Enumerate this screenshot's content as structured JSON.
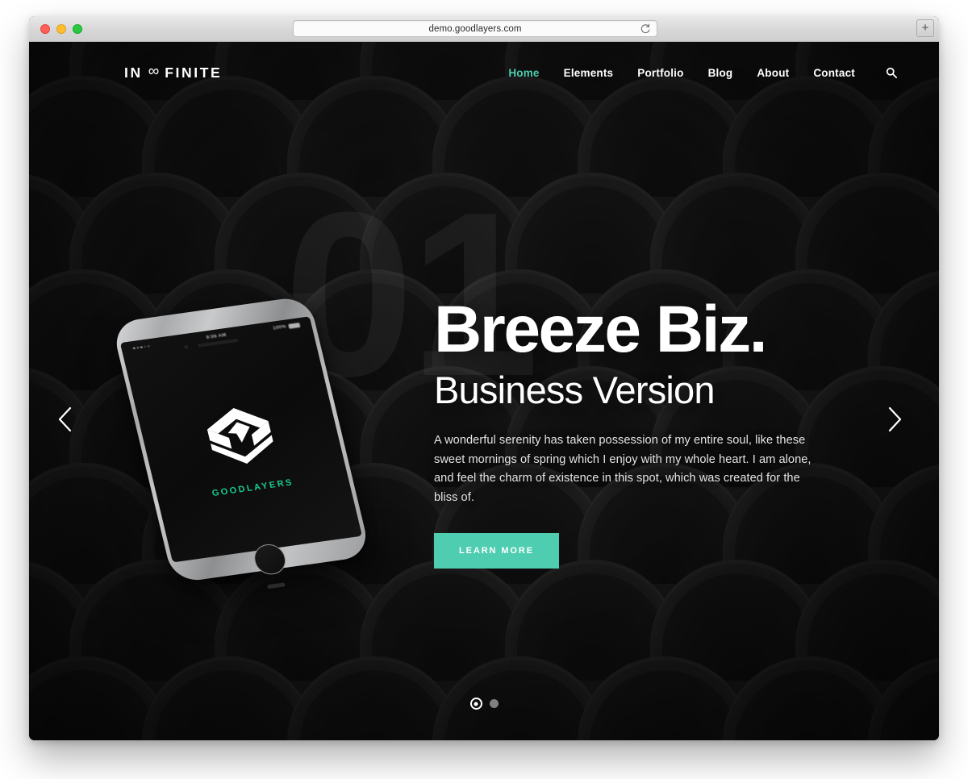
{
  "browser": {
    "url": "demo.goodlayers.com",
    "reload_icon": "reload-icon",
    "newtab_label": "+",
    "traffic_lights": [
      "close",
      "minimize",
      "maximize"
    ]
  },
  "site": {
    "logo": {
      "left": "IN",
      "symbol": "∞",
      "right": "FINITE"
    },
    "nav": [
      {
        "label": "Home",
        "active": true
      },
      {
        "label": "Elements",
        "active": false
      },
      {
        "label": "Portfolio",
        "active": false
      },
      {
        "label": "Blog",
        "active": false
      },
      {
        "label": "About",
        "active": false
      },
      {
        "label": "Contact",
        "active": false
      }
    ],
    "search_icon": "search-icon"
  },
  "hero": {
    "slide_number": "01",
    "title": "Breeze Biz.",
    "subtitle": "Business Version",
    "paragraph": "A wonderful serenity has taken possession of my entire soul, like these sweet mornings of spring which I enjoy with my whole heart. I am alone, and feel the charm of existence in this spot, which was created for the bliss of.",
    "cta_label": "LEARN MORE",
    "accent_color": "#4ecdb0",
    "prev_arrow": "chevron-left-icon",
    "next_arrow": "chevron-right-icon",
    "dots": [
      {
        "active": true
      },
      {
        "active": false
      }
    ]
  },
  "phone": {
    "status_time": "9:06 AM",
    "status_battery": "100%",
    "app_name": "GOODLAYERS",
    "app_name_color": "#19c98f",
    "app_logo": "layers-box-icon"
  }
}
